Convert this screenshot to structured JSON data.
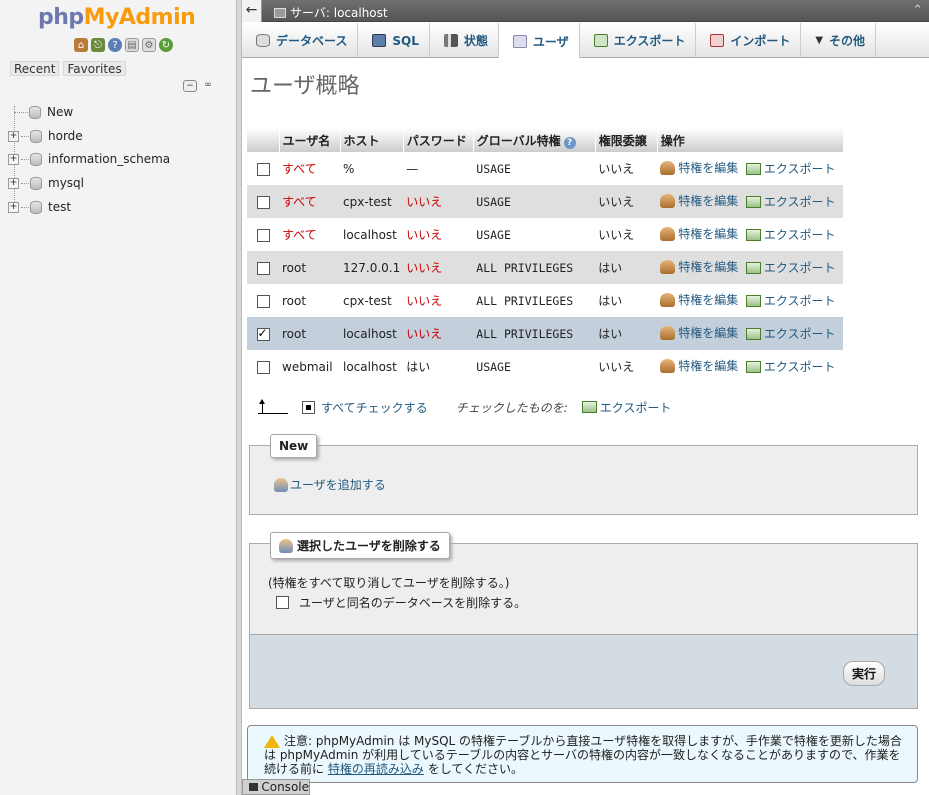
{
  "nav": {
    "logo_part1": "php",
    "logo_part2": "MyAdmin",
    "recent_label": "Recent",
    "favorites_label": "Favorites",
    "tree": [
      "New",
      "horde",
      "information_schema",
      "mysql",
      "test"
    ]
  },
  "serverbar": {
    "back_glyph": "←",
    "server_label": "サーバ: localhost",
    "collapse_glyph": "⌃"
  },
  "tabs": [
    {
      "label": "データベース",
      "icon": "database-icon"
    },
    {
      "label": "SQL",
      "icon": "sql-icon"
    },
    {
      "label": "状態",
      "icon": "status-icon"
    },
    {
      "label": "ユーザ",
      "icon": "users-icon"
    },
    {
      "label": "エクスポート",
      "icon": "export-icon"
    },
    {
      "label": "インポート",
      "icon": "import-icon"
    },
    {
      "label": "その他",
      "icon": "more-icon"
    }
  ],
  "page": {
    "title": "ユーザ概略"
  },
  "table": {
    "headers": [
      "ユーザ名",
      "ホスト",
      "パスワード",
      "グローバル特権",
      "権限委譲",
      "操作"
    ],
    "edit_label": "特権を編集",
    "export_label": "エクスポート",
    "rows": [
      {
        "user": "すべて",
        "user_red": true,
        "host": "%",
        "password": "—",
        "password_red": false,
        "priv": "USAGE",
        "grant": "いいえ",
        "checked": false
      },
      {
        "user": "すべて",
        "user_red": true,
        "host": "cpx-test",
        "password": "いいえ",
        "password_red": true,
        "priv": "USAGE",
        "grant": "いいえ",
        "checked": false
      },
      {
        "user": "すべて",
        "user_red": true,
        "host": "localhost",
        "password": "いいえ",
        "password_red": true,
        "priv": "USAGE",
        "grant": "いいえ",
        "checked": false
      },
      {
        "user": "root",
        "user_red": false,
        "host": "127.0.0.1",
        "password": "いいえ",
        "password_red": true,
        "priv": "ALL PRIVILEGES",
        "grant": "はい",
        "checked": false
      },
      {
        "user": "root",
        "user_red": false,
        "host": "cpx-test",
        "password": "いいえ",
        "password_red": true,
        "priv": "ALL PRIVILEGES",
        "grant": "はい",
        "checked": false
      },
      {
        "user": "root",
        "user_red": false,
        "host": "localhost",
        "password": "いいえ",
        "password_red": true,
        "priv": "ALL PRIVILEGES",
        "grant": "はい",
        "checked": true
      },
      {
        "user": "webmail",
        "user_red": false,
        "host": "localhost",
        "password": "はい",
        "password_red": false,
        "priv": "USAGE",
        "grant": "いいえ",
        "checked": false
      }
    ]
  },
  "checkall": {
    "check_all_label": "すべてチェックする",
    "with_selected_label": "チェックしたものを:",
    "export_label": "エクスポート"
  },
  "new_section": {
    "legend": "New",
    "add_user_label": "ユーザを追加する"
  },
  "delete_section": {
    "legend": "選択したユーザを削除する",
    "description": "(特権をすべて取り消してユーザを削除する。)",
    "drop_db_label": "ユーザと同名のデータベースを削除する。",
    "go_label": "実行"
  },
  "notice": {
    "text_before": "注意: phpMyAdmin は MySQL の特権テーブルから直接ユーザ特権を取得しますが、手作業で特権を更新した場合は phpMyAdmin が利用しているテーブルの内容とサーバの特権の内容が一致しなくなることがありますので、作業を続ける前に",
    "link_text": "特権の再読み込み",
    "text_after": "をしてください。"
  },
  "console": {
    "label": "Console"
  },
  "colors": {
    "link": "#235a81",
    "red": "#cc0000",
    "marked_row": "#c3cfdb"
  }
}
